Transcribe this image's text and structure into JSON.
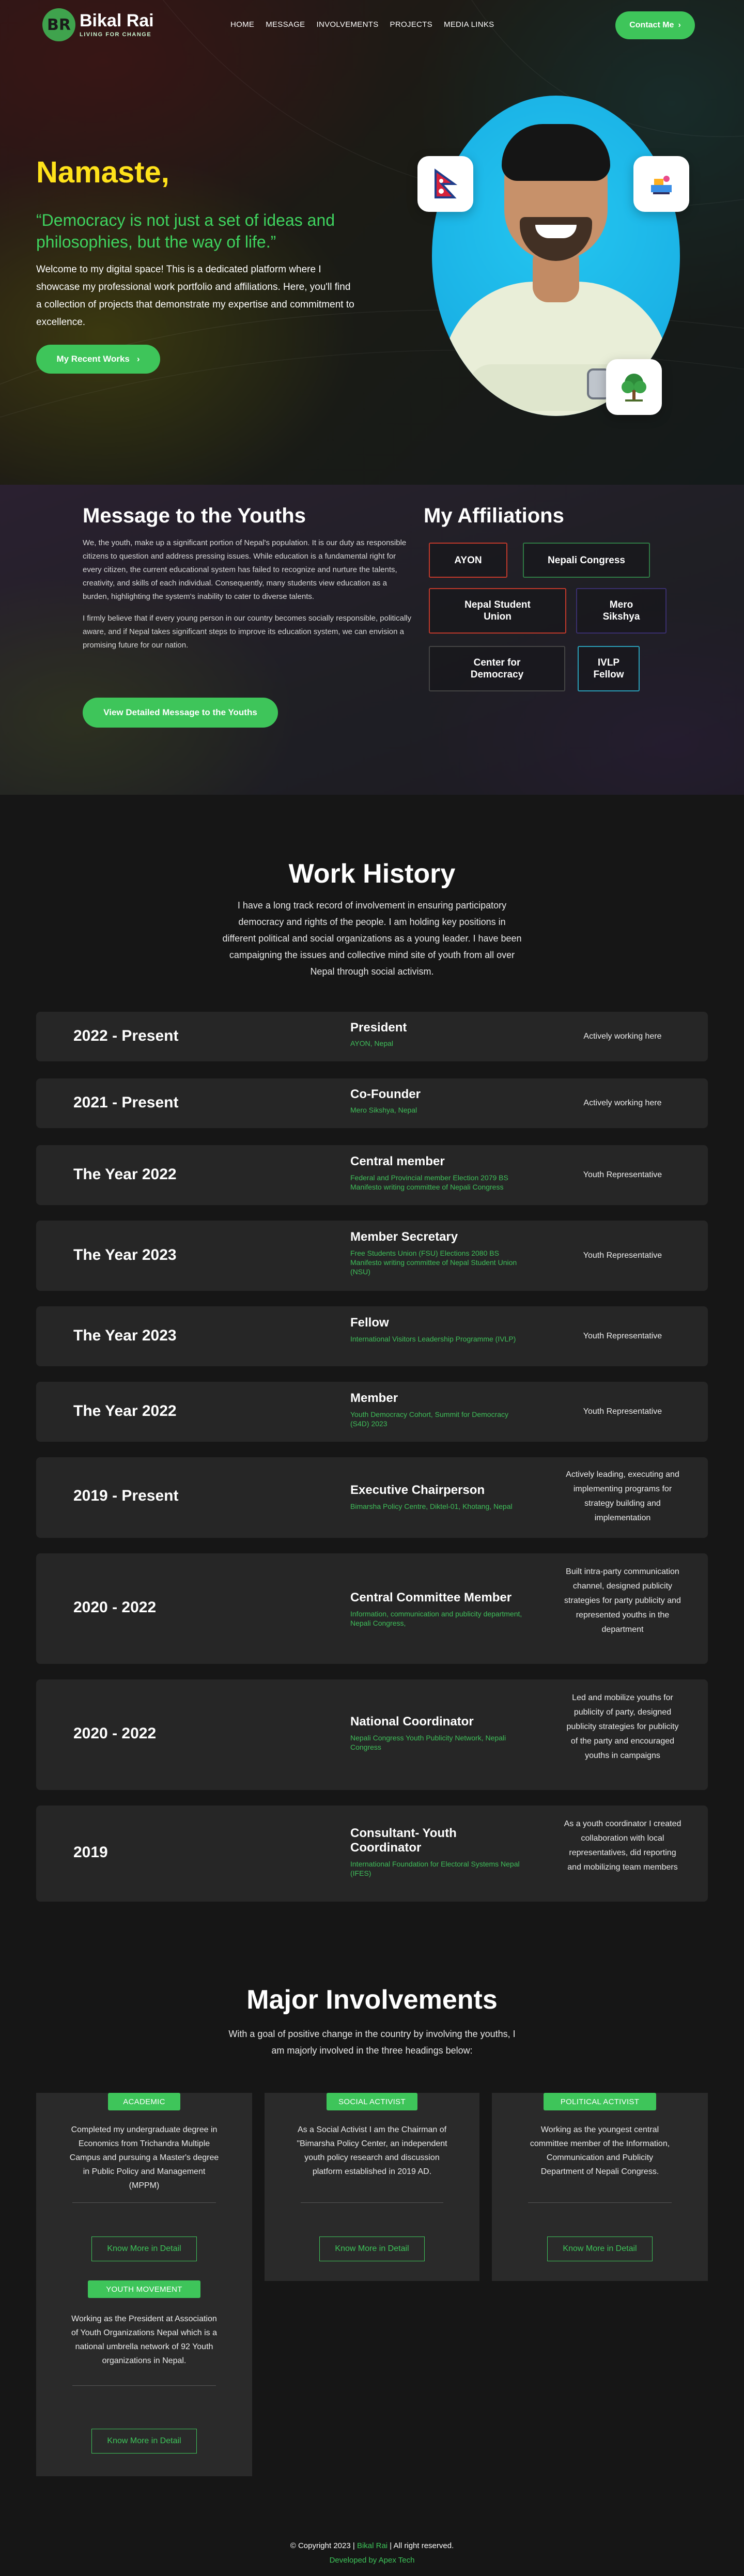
{
  "brand": {
    "logo_initials": "BR",
    "name": "Bikal Rai",
    "tagline": "LIVING FOR CHANGE"
  },
  "nav": {
    "items": [
      "HOME",
      "MESSAGE",
      "INVOLVEMENTS",
      "PROJECTS",
      "MEDIA LINKS"
    ],
    "contact_label": "Contact Me"
  },
  "hero": {
    "greeting": "Namaste,",
    "quote": "“Democracy is not just a set of ideas and philosophies, but the way of life.”",
    "intro": "Welcome to my digital space! This is a dedicated platform where I showcase my professional work portfolio and affiliations. Here, you'll find a collection of projects that demonstrate my expertise and commitment to excellence.",
    "cta_label": "My Recent Works"
  },
  "message": {
    "title": "Message to the Youths",
    "paragraphs": [
      "We, the youth, make up a significant portion of Nepal's population. It is our duty as responsible citizens to question and address pressing issues. While education is a fundamental right for every citizen, the current educational system has failed to recognize and nurture the talents, creativity, and skills of each individual. Consequently, many students view education as a burden, highlighting the system's inability to cater to diverse talents.",
      "I firmly believe that if every young person in our country becomes socially responsible, politically aware, and if Nepal takes significant steps to improve its education system, we can envision a promising future for our nation."
    ],
    "cta_label": "View Detailed Message to the Youths"
  },
  "affiliations": {
    "title": "My Affiliations",
    "items": [
      {
        "label": "AYON",
        "color": "#c0392b"
      },
      {
        "label": "Nepali Congress",
        "color": "#2f7a45"
      },
      {
        "label": "Nepal Student Union",
        "color": "#c0392b"
      },
      {
        "label": "Mero Sikshya",
        "color": "#3a2f6e"
      },
      {
        "label": "Center for Democracy",
        "color": "#444444"
      },
      {
        "label": "IVLP Fellow",
        "color": "#2a9fb8"
      }
    ]
  },
  "work_history": {
    "title": "Work History",
    "subtitle": "I have a long track record of involvement in ensuring participatory democracy and rights of the people. I am holding key positions in different political and social organizations as a young leader. I have been campaigning the issues and collective mind site of youth from all over Nepal through social activism.",
    "jobs": [
      {
        "year": "2022 - Present",
        "role": "President",
        "org": "AYON, Nepal",
        "desc": "Actively working here"
      },
      {
        "year": "2021 - Present",
        "role": "Co-Founder",
        "org": "Mero Sikshya, Nepal",
        "desc": "Actively working here"
      },
      {
        "year": "The Year 2022",
        "role": "Central member",
        "org": "Federal and Provincial member Election 2079 BS Manifesto writing committee of Nepali Congress",
        "desc": "Youth Representative"
      },
      {
        "year": "The Year 2023",
        "role": "Member Secretary",
        "org": "Free Students Union (FSU) Elections 2080 BS Manifesto writing committee of Nepal Student Union (NSU)",
        "desc": "Youth Representative"
      },
      {
        "year": "The Year 2023",
        "role": "Fellow",
        "org": "International Visitors Leadership Programme (IVLP)",
        "desc": "Youth Representative"
      },
      {
        "year": "The Year 2022",
        "role": "Member",
        "org": "Youth Democracy Cohort, Summit for Democracy (S4D) 2023",
        "desc": "Youth Representative"
      },
      {
        "year": "2019 - Present",
        "role": "Executive Chairperson",
        "org": "Bimarsha Policy Centre, Diktel-01, Khotang, Nepal",
        "desc": "Actively leading, executing and implementing programs for strategy building and implementation"
      },
      {
        "year": "2020 - 2022",
        "role": "Central Committee Member",
        "org": "Information, communication and publicity department, Nepali Congress,",
        "desc": "Built intra-party communication channel, designed publicity strategies for party publicity and represented youths in the department"
      },
      {
        "year": "2020 - 2022",
        "role": "National Coordinator",
        "org": "Nepali Congress Youth Publicity Network, Nepali Congress",
        "desc": "Led and mobilize youths for publicity of party, designed publicity strategies for publicity of the party and encouraged youths in campaigns"
      },
      {
        "year": "2019",
        "role": "Consultant- Youth Coordinator",
        "org": "International Foundation for Electoral Systems Nepal (IFES)",
        "desc": "As a youth coordinator I created collaboration with local representatives, did reporting and mobilizing team members"
      }
    ]
  },
  "involvements": {
    "title": "Major Involvements",
    "subtitle": "With a goal of positive change in the country by involving the youths, I am majorly involved in the three headings below:",
    "button_label": "Know More in Detail",
    "cards": [
      {
        "tag": "ACADEMIC",
        "text": "Completed my undergraduate degree in Economics from Trichandra Multiple Campus and pursuing a Master's degree in Public Policy and Management (MPPM)"
      },
      {
        "tag": "SOCIAL ACTIVIST",
        "text": "As a Social Activist I am the Chairman of \"Bimarsha Policy Center, an independent youth policy research and discussion platform established in 2019 AD."
      },
      {
        "tag": "POLITICAL ACTIVIST",
        "text": "Working as the youngest central committee member of the Information, Communication and Publicity Department of Nepali Congress."
      },
      {
        "tag": "YOUTH MOVEMENT",
        "text": "Working as the President at Association of Youth Organizations Nepal which is a national umbrella network of 92 Youth organizations in Nepal."
      }
    ]
  },
  "footer": {
    "copyright_prefix": "© Copyright 2023 |",
    "copyright_name": "Bikal Rai",
    "copyright_suffix": "| All right reserved.",
    "developer": "Developed by Apex Tech"
  }
}
